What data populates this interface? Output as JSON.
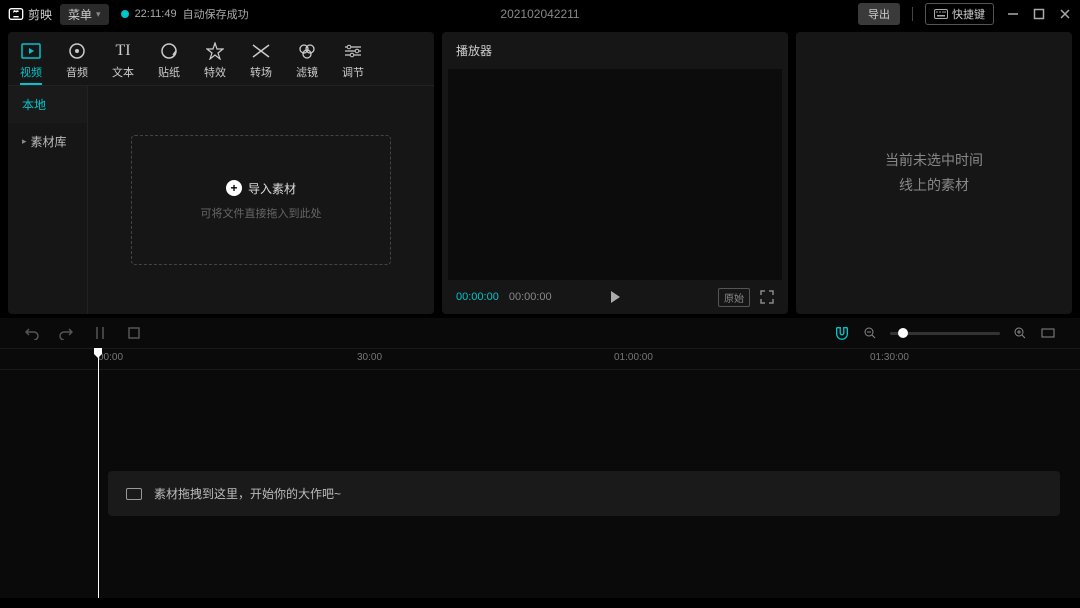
{
  "topbar": {
    "app_name": "剪映",
    "menu_label": "菜单",
    "autosave_time": "22:11:49",
    "autosave_text": "自动保存成功",
    "project_name": "202102042211",
    "export_label": "导出",
    "shortcut_label": "快捷键"
  },
  "media_tabs": [
    {
      "label": "视频",
      "icon": "video"
    },
    {
      "label": "音频",
      "icon": "audio"
    },
    {
      "label": "文本",
      "icon": "text"
    },
    {
      "label": "贴纸",
      "icon": "sticker"
    },
    {
      "label": "特效",
      "icon": "fx"
    },
    {
      "label": "转场",
      "icon": "transition"
    },
    {
      "label": "滤镜",
      "icon": "filter"
    },
    {
      "label": "调节",
      "icon": "adjust"
    }
  ],
  "side_tabs": {
    "local": "本地",
    "library": "素材库"
  },
  "import": {
    "button": "导入素材",
    "hint": "可将文件直接拖入到此处"
  },
  "player": {
    "title": "播放器",
    "current_time": "00:00:00",
    "total_time": "00:00:00",
    "ratio_label": "原始"
  },
  "inspector": {
    "empty_line1": "当前未选中时间",
    "empty_line2": "线上的素材"
  },
  "ruler": {
    "t0": "00:00",
    "t1": "30:00",
    "t2": "01:00:00",
    "t3": "01:30:00"
  },
  "timeline": {
    "hint": "素材拖拽到这里，开始你的大作吧~"
  }
}
